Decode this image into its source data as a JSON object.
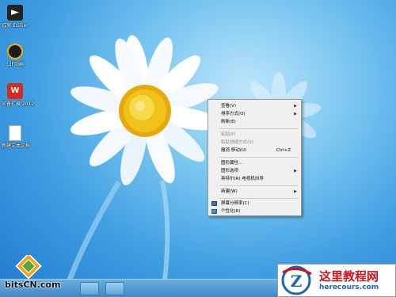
{
  "desktop_icons": [
    {
      "label": "成就 EGGer",
      "icon": "app-icon"
    },
    {
      "label": "GIF动画",
      "icon": "camera-icon"
    },
    {
      "label": "实备扩展 2012",
      "icon": "wps-icon"
    },
    {
      "label": "新建文本文档",
      "icon": "text-document-icon"
    }
  ],
  "context_menu": {
    "items": [
      {
        "label": "查看(V)",
        "submenu": true,
        "disabled": false
      },
      {
        "label": "排序方式(O)",
        "submenu": true,
        "disabled": false
      },
      {
        "label": "刷新(E)",
        "submenu": false,
        "disabled": false
      },
      {
        "label": "粘贴(P)",
        "submenu": false,
        "disabled": true
      },
      {
        "label": "粘贴快捷方式(S)",
        "submenu": false,
        "disabled": true
      },
      {
        "label": "撤消 移动(U)",
        "shortcut": "Ctrl+Z",
        "submenu": false,
        "disabled": false
      },
      {
        "label": "图形属性...",
        "submenu": false,
        "disabled": false
      },
      {
        "label": "图形选项",
        "submenu": true,
        "disabled": false
      },
      {
        "label": "英特尔(R) 电视机向导",
        "submenu": false,
        "disabled": false
      },
      {
        "label": "新建(W)",
        "submenu": true,
        "disabled": false
      },
      {
        "label": "屏幕分辨率(C)",
        "submenu": false,
        "disabled": false,
        "icon": "display-icon"
      },
      {
        "label": "个性化(R)",
        "submenu": false,
        "disabled": false,
        "icon": "personalize-icon"
      }
    ]
  },
  "watermark_left": {
    "text": "bitsCN.com"
  },
  "watermark_right": {
    "title": "这里教程网",
    "url": "herecours.com"
  },
  "colors": {
    "menu_bg": "#f0f0f0",
    "wallpaper_blue": "#3f9fe2",
    "daisy_center": "#f0c21a",
    "watermark_red": "#c8161d",
    "watermark_blue": "#1d63b7"
  }
}
